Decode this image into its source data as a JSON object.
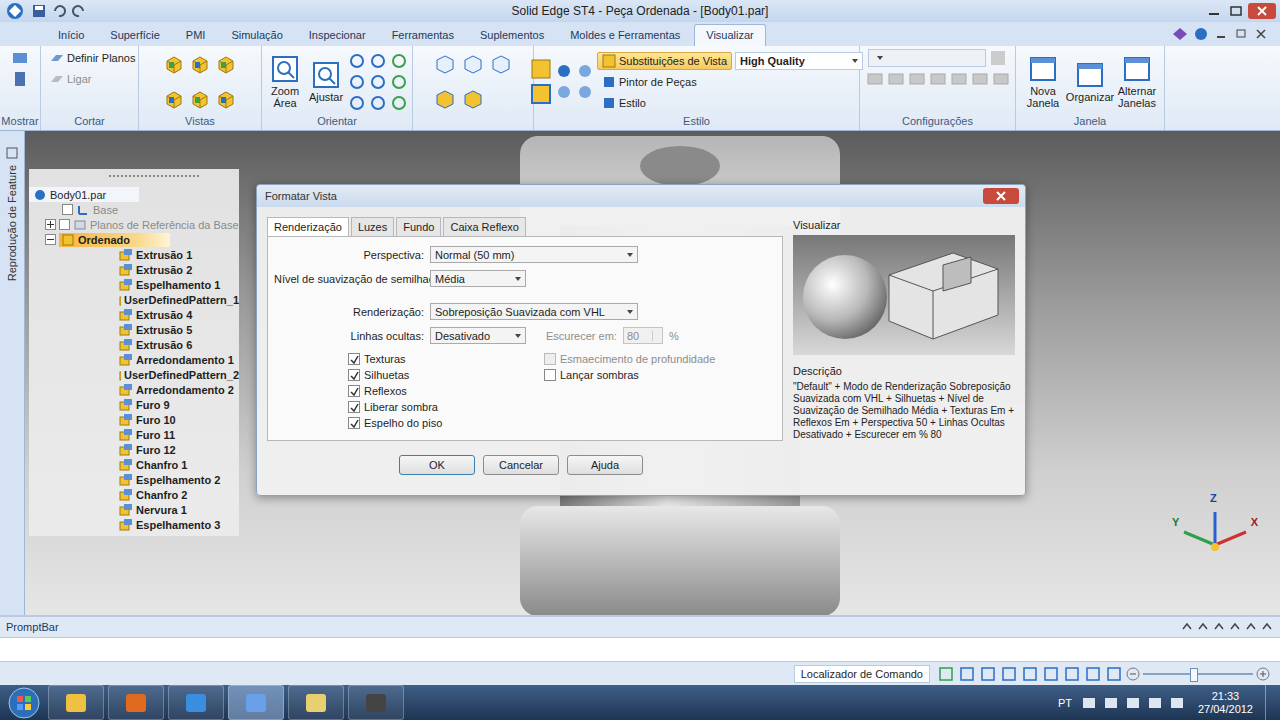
{
  "window": {
    "title": "Solid Edge ST4 - Peça Ordenada - [Body01.par]"
  },
  "menu_tabs": [
    {
      "label": "Início",
      "selected": false
    },
    {
      "label": "Superfície",
      "selected": false
    },
    {
      "label": "PMI",
      "selected": false
    },
    {
      "label": "Simulação",
      "selected": false
    },
    {
      "label": "Inspecionar",
      "selected": false
    },
    {
      "label": "Ferramentas",
      "selected": false
    },
    {
      "label": "Suplementos",
      "selected": false
    },
    {
      "label": "Moldes e Ferramentas",
      "selected": false
    },
    {
      "label": "Visualizar",
      "selected": true
    }
  ],
  "ribbon": {
    "mostrar": {
      "label": "Mostrar"
    },
    "cortar": {
      "label": "Cortar",
      "items": [
        {
          "label": "Definir Planos",
          "disabled": false
        },
        {
          "label": "Ligar",
          "disabled": true
        }
      ]
    },
    "vistas": {
      "label": "Vistas"
    },
    "orientar": {
      "label": "Orientar",
      "buttons": [
        "Zoom Área",
        "Ajustar"
      ]
    },
    "estilo": {
      "label": "Estilo",
      "override": {
        "label": "Substituições de Vista",
        "selected": true
      },
      "quality": "High Quality",
      "items": [
        "Pintor de Peças",
        "Estilo"
      ]
    },
    "configuracoes": {
      "label": "Configurações",
      "disabled": true
    },
    "janela": {
      "label": "Janela",
      "buttons": [
        "Nova Janela",
        "Organizar",
        "Alternar Janelas"
      ]
    }
  },
  "side_tab": "Reprodução de Feature",
  "tree": {
    "root": "Body01.par",
    "base": {
      "label": "Base",
      "checked": false
    },
    "ref_planes": {
      "label": "Planos de Referência da Base",
      "expanded": false,
      "checked": false
    },
    "ordered": {
      "label": "Ordenado",
      "expanded": true,
      "selected": true
    },
    "features": [
      {
        "label": "Extrusão 1",
        "selected": false
      },
      {
        "label": "Extrusão 2",
        "selected": false
      },
      {
        "label": "Espelhamento 1",
        "selected": false
      },
      {
        "label": "UserDefinedPattern_1",
        "selected": false
      },
      {
        "label": "Extrusão 4",
        "selected": false
      },
      {
        "label": "Extrusão 5",
        "selected": false
      },
      {
        "label": "Extrusão 6",
        "selected": false
      },
      {
        "label": "Arredondamento 1",
        "selected": false
      },
      {
        "label": "UserDefinedPattern_2",
        "selected": false
      },
      {
        "label": "Arredondamento 2",
        "selected": false
      },
      {
        "label": "Furo 9",
        "selected": false
      },
      {
        "label": "Furo 10",
        "selected": false
      },
      {
        "label": "Furo 11",
        "selected": false
      },
      {
        "label": "Furo 12",
        "selected": false
      },
      {
        "label": "Chanfro 1",
        "selected": false
      },
      {
        "label": "Espelhamento 2",
        "selected": false
      },
      {
        "label": "Chanfro 2",
        "selected": false
      },
      {
        "label": "Nervura 1",
        "selected": false
      },
      {
        "label": "Espelhamento 3",
        "selected": false
      }
    ]
  },
  "dialog": {
    "title": "Formatar Vista",
    "tabs": [
      {
        "label": "Renderização",
        "selected": true
      },
      {
        "label": "Luzes",
        "selected": false
      },
      {
        "label": "Fundo",
        "selected": false
      },
      {
        "label": "Caixa Reflexo",
        "selected": false
      }
    ],
    "fields": [
      {
        "label": "Perspectiva:",
        "value": "Normal (50 mm)",
        "wide": true
      },
      {
        "label": "Nível de suavização de semilhado:",
        "value": "Média",
        "wide": false
      },
      {
        "label": "Renderização:",
        "value": "Sobreposição Suavizada com VHL",
        "wide": true
      },
      {
        "label": "Linhas ocultas:",
        "value": "Desativado",
        "wide": false
      }
    ],
    "dim": {
      "label": "Escurecer em:",
      "value": "80",
      "unit": "%",
      "disabled": true
    },
    "checks_left": [
      {
        "label": "Texturas",
        "checked": true,
        "disabled": false
      },
      {
        "label": "Silhuetas",
        "checked": true,
        "disabled": false
      },
      {
        "label": "Reflexos",
        "checked": true,
        "disabled": false
      },
      {
        "label": "Liberar sombra",
        "checked": true,
        "disabled": false
      },
      {
        "label": "Espelho do piso",
        "checked": true,
        "disabled": false
      }
    ],
    "checks_right": [
      {
        "label": "Esmaecimento de profundidade",
        "checked": false,
        "disabled": true
      },
      {
        "label": "Lançar sombras",
        "checked": false,
        "disabled": false
      }
    ],
    "preview_label": "Visualizar",
    "description_label": "Descrição",
    "description": "\"Default\" + Modo de Renderização Sobreposição Suavizada com VHL + Silhuetas + Nível de Suavização de Semilhado Média + Texturas Em + Reflexos Em + Perspectiva 50 + Linhas Ocultas Desativado + Escurecer em % 80",
    "buttons": [
      "OK",
      "Cancelar",
      "Ajuda"
    ]
  },
  "triad": {
    "z": "Z",
    "y": "Y",
    "x": "X"
  },
  "promptbar": {
    "title": "PromptBar"
  },
  "status": {
    "command_locator": "Localizador de Comando",
    "zoom_level": 0.45
  },
  "taskbar": {
    "language": "PT",
    "time": "21:33",
    "date": "27/04/2012",
    "apps": [
      {
        "selected": false
      },
      {
        "selected": false
      },
      {
        "selected": false
      },
      {
        "selected": true
      },
      {
        "selected": false
      },
      {
        "selected": false
      }
    ]
  }
}
